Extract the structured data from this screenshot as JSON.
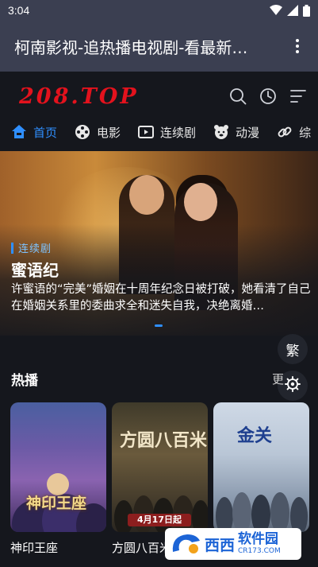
{
  "status_bar": {
    "time": "3:04",
    "icons": [
      "wifi-icon",
      "signal-icon",
      "battery-icon"
    ]
  },
  "app_bar": {
    "title": "柯南影视-追热播电视剧-看最新…",
    "menu_icon": "more-vert-icon"
  },
  "site_header": {
    "logo": "208.TOP",
    "icons": [
      "search-icon",
      "history-icon",
      "filter-icon"
    ]
  },
  "nav": {
    "items": [
      {
        "label": "首页",
        "icon": "home-icon",
        "active": true
      },
      {
        "label": "电影",
        "icon": "film-reel-icon",
        "active": false
      },
      {
        "label": "连续剧",
        "icon": "tv-play-icon",
        "active": false
      },
      {
        "label": "动漫",
        "icon": "bear-icon",
        "active": false
      },
      {
        "label": "综",
        "icon": "link-icon",
        "active": false
      }
    ]
  },
  "banner": {
    "tag": "连续剧",
    "title": "蜜语纪",
    "description": "许蜜语的“完美”婚姻在十周年纪念日被打破，她看清了自己在婚姻关系里的委曲求全和迷失自我，决绝离婚…"
  },
  "float_buttons": {
    "traditional": "繁",
    "settings_icon": "gear-icon"
  },
  "hot_section": {
    "title": "热播",
    "more": "更",
    "cards": [
      {
        "title": "神印王座",
        "poster_text": "神印王座"
      },
      {
        "title": "方圆八百米",
        "poster_text": "方圆八百米",
        "poster_date": "4月17日起"
      },
      {
        "title": "",
        "poster_text": "金关"
      }
    ]
  },
  "watermark": {
    "brand": "软件园",
    "main": "西西",
    "url": "CR173.COM"
  },
  "colors": {
    "accent": "#2f8fff",
    "logo": "#e3121d",
    "app_bar": "#3b3f51",
    "background": "#15171d"
  }
}
